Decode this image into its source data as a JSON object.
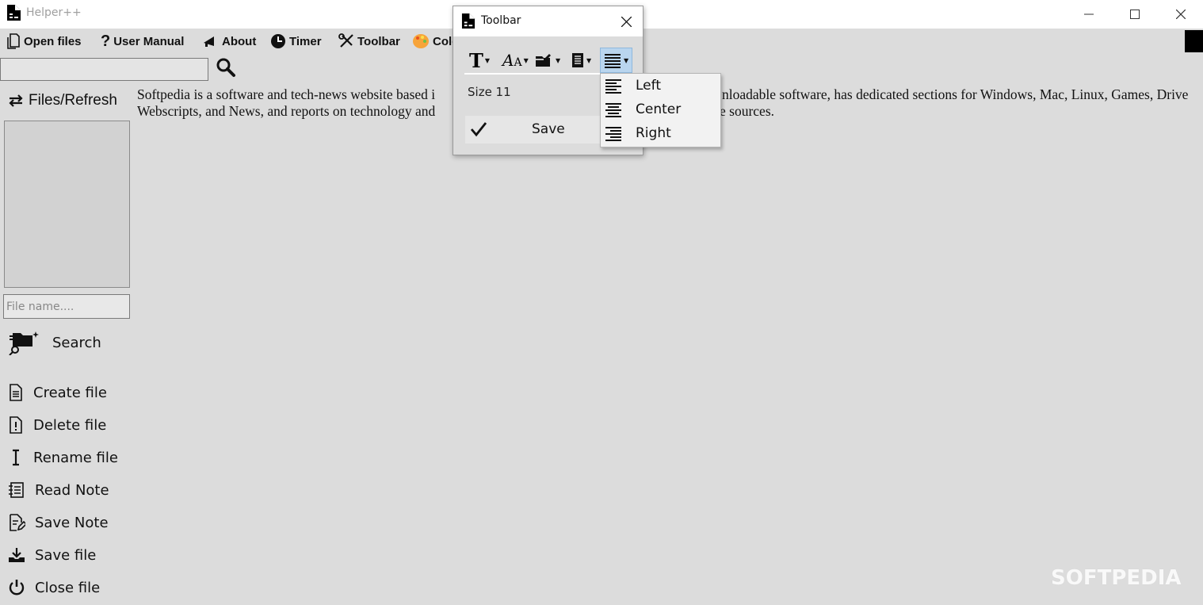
{
  "window": {
    "title": "Helper++",
    "controls": [
      "minimize",
      "maximize",
      "close"
    ]
  },
  "menu": {
    "items": [
      {
        "label": "Open files",
        "icon": "open-files-icon"
      },
      {
        "label": "User Manual",
        "icon": "question-icon"
      },
      {
        "label": "About",
        "icon": "megaphone-icon"
      },
      {
        "label": "Timer",
        "icon": "clock-icon"
      },
      {
        "label": "Toolbar",
        "icon": "tools-icon"
      },
      {
        "label": "Colo",
        "icon": "palette-icon"
      }
    ]
  },
  "search": {
    "value": "",
    "icon": "search-icon"
  },
  "sidebar": {
    "refresh_label": "Files/Refresh",
    "file_name_placeholder": "File name....",
    "search_label": "Search",
    "buttons": [
      {
        "label": "Create file",
        "icon": "file-icon"
      },
      {
        "label": "Delete file",
        "icon": "file-alert-icon"
      },
      {
        "label": "Rename file",
        "icon": "text-cursor-icon"
      },
      {
        "label": "Read Note",
        "icon": "notebook-icon"
      },
      {
        "label": "Save Note",
        "icon": "note-edit-icon"
      },
      {
        "label": "Save file",
        "icon": "download-tray-icon"
      },
      {
        "label": "Close file",
        "icon": "power-icon"
      }
    ]
  },
  "editor": {
    "line1_left": "Softpedia is a software and tech-news website based i",
    "line1_right": "nloadable software, has dedicated sections for Windows, Mac, Linux, Games, Drive",
    "line2_left": "Webscripts, and News, and reports on technology and",
    "line2_right": "e sources."
  },
  "toolbar_dialog": {
    "title": "Toolbar",
    "tools": [
      "font-type-icon",
      "font-size-icon",
      "insert-image-icon",
      "document-icon",
      "align-icon"
    ],
    "size_label": "Size 11",
    "save_label": "Save"
  },
  "align_menu": {
    "items": [
      "Left",
      "Center",
      "Right"
    ]
  },
  "watermark": "SOFTPEDIA"
}
